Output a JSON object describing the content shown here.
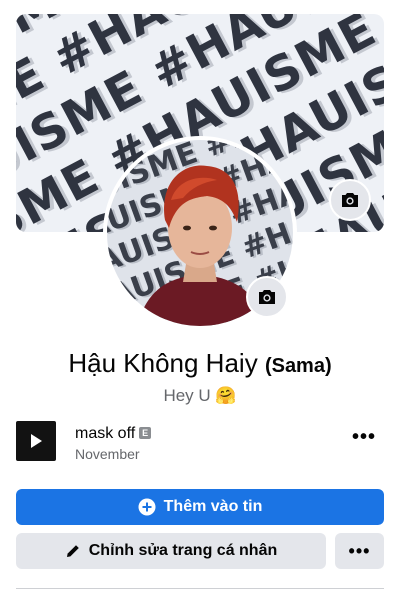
{
  "cover": {
    "pattern_text": "#HAUISME"
  },
  "profile": {
    "name": "Hậu Không Haiy",
    "nickname": "(Sama)",
    "bio": "Hey U 🤗"
  },
  "music": {
    "song_title": "mask off",
    "explicit_badge": "E",
    "artist": "November",
    "more_label": "•••"
  },
  "actions": {
    "add_story_label": "Thêm vào tin",
    "edit_profile_label": "Chỉnh sửa trang cá nhân",
    "more_label": "•••"
  },
  "colors": {
    "primary": "#1b74e4",
    "secondary_button": "#e4e6eb",
    "muted_text": "#65676b"
  },
  "icons": [
    "camera-icon",
    "play-icon",
    "plus-circle-icon",
    "pencil-icon",
    "more-icon"
  ]
}
